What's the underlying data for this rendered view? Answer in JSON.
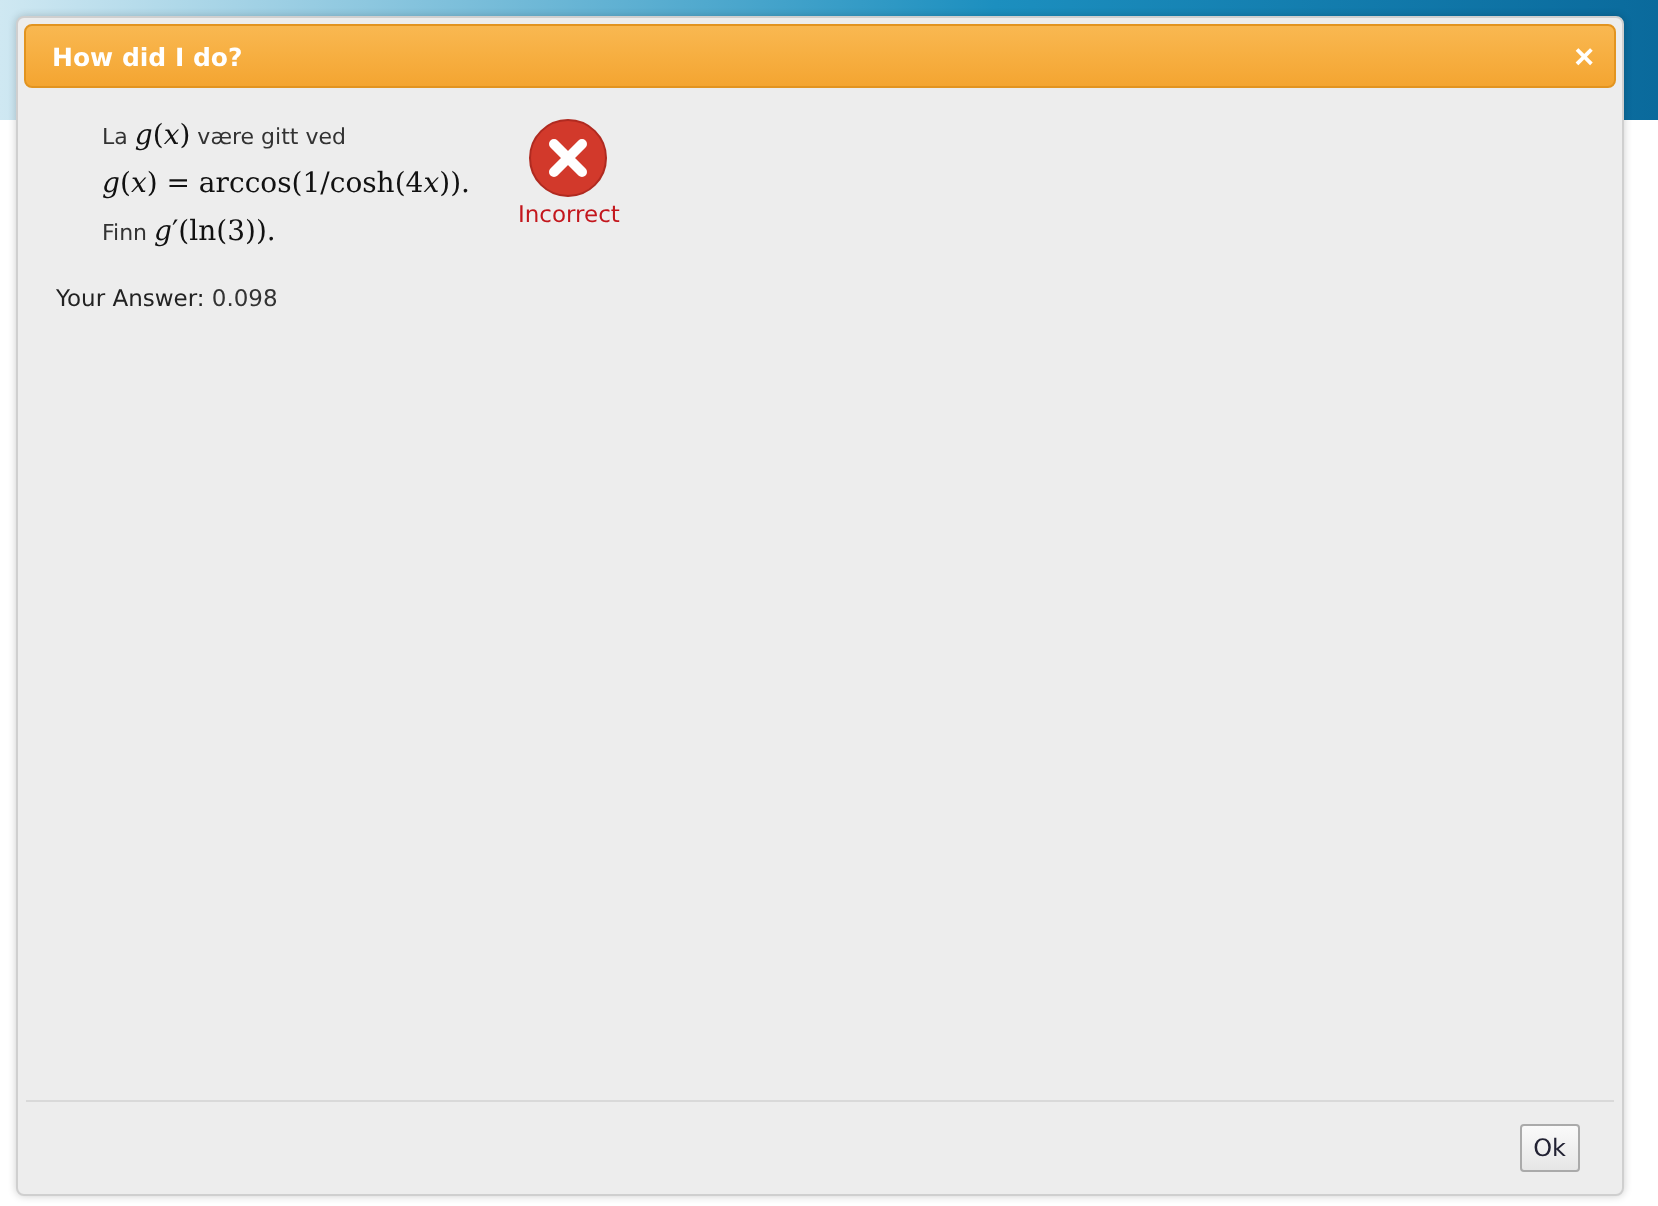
{
  "dialog": {
    "title": "How did I do?",
    "close": "×",
    "question": [
      [
        {
          "kind": "text",
          "text": "La "
        },
        {
          "kind": "math",
          "text": "*g*(*x*)"
        },
        {
          "kind": "text",
          "text": " være gitt ved"
        }
      ],
      [
        {
          "kind": "math",
          "text": "*g*(*x*) = arccos(1/cosh(4"
        },
        {
          "kind": "var",
          "text": "x"
        },
        {
          "kind": "math",
          "text": "))."
        }
      ],
      [
        {
          "kind": "text",
          "text": "Finn "
        },
        {
          "kind": "math",
          "text": "*g*′(ln(3))."
        }
      ]
    ],
    "result": {
      "correct": false,
      "label": "Incorrect"
    },
    "answer_label": "Your Answer:",
    "answer_value": "0.098",
    "buttons": [
      "Ok"
    ]
  }
}
